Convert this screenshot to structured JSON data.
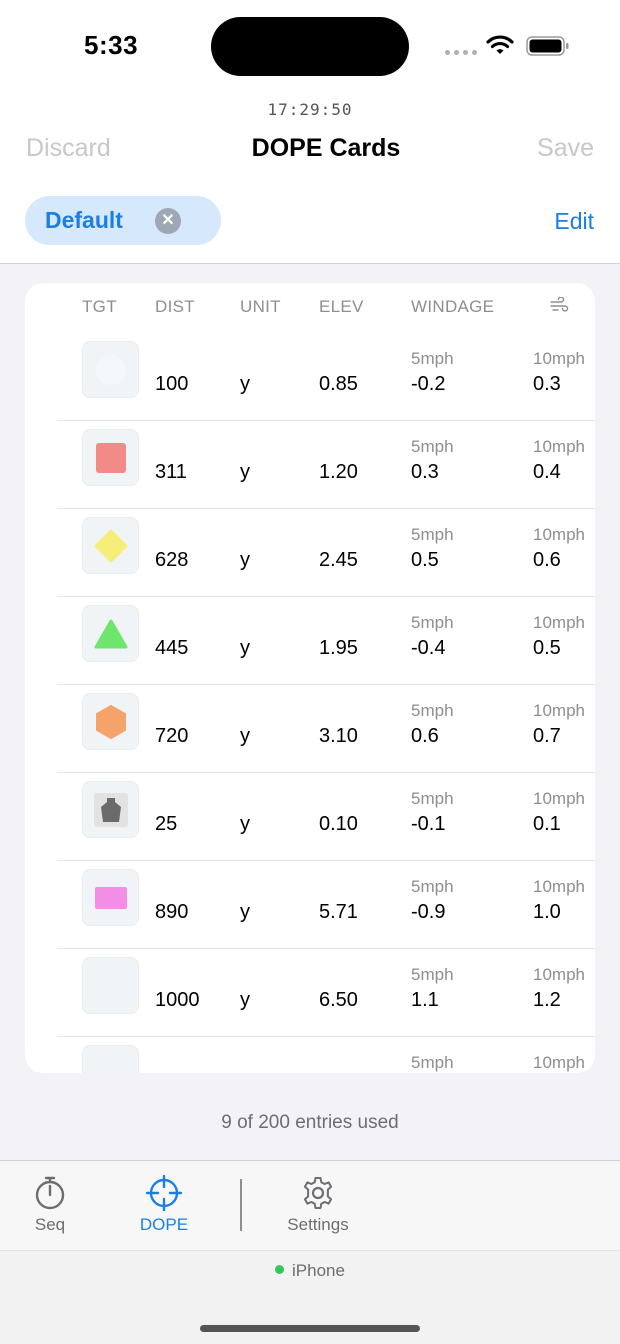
{
  "status_bar": {
    "time": "5:33"
  },
  "clock": "17:29:50",
  "nav": {
    "left": "Discard",
    "title": "DOPE Cards",
    "right": "Save"
  },
  "filter": {
    "chip_label": "Default",
    "edit_label": "Edit"
  },
  "table": {
    "headers": {
      "tgt": "TGT",
      "dist": "DIST",
      "unit": "UNIT",
      "elev": "ELEV",
      "windage": "WINDAGE",
      "wind_icon": "wind-icon"
    },
    "rows": [
      {
        "target": "circle-white",
        "target_color": "#f4f8fa",
        "dist": "100",
        "unit": "y",
        "elev": "0.85",
        "w1_label": "5mph",
        "w1": "-0.2",
        "w2_label": "10mph",
        "w2": "0.3"
      },
      {
        "target": "square-red",
        "target_color": "#f28a87",
        "dist": "311",
        "unit": "y",
        "elev": "1.20",
        "w1_label": "5mph",
        "w1": "0.3",
        "w2_label": "10mph",
        "w2": "0.4"
      },
      {
        "target": "diamond-yellow",
        "target_color": "#f7ee7a",
        "dist": "628",
        "unit": "y",
        "elev": "2.45",
        "w1_label": "5mph",
        "w1": "0.5",
        "w2_label": "10mph",
        "w2": "0.6"
      },
      {
        "target": "triangle-green",
        "target_color": "#6ee66e",
        "dist": "445",
        "unit": "y",
        "elev": "1.95",
        "w1_label": "5mph",
        "w1": "-0.4",
        "w2_label": "10mph",
        "w2": "0.5"
      },
      {
        "target": "hexagon-orange",
        "target_color": "#f6a36b",
        "dist": "720",
        "unit": "y",
        "elev": "3.10",
        "w1_label": "5mph",
        "w1": "0.6",
        "w2_label": "10mph",
        "w2": "0.7"
      },
      {
        "target": "ipsc-gray",
        "target_color": "#6b6b6b",
        "dist": "25",
        "unit": "y",
        "elev": "0.10",
        "w1_label": "5mph",
        "w1": "-0.1",
        "w2_label": "10mph",
        "w2": "0.1"
      },
      {
        "target": "rectangle-pink",
        "target_color": "#f38ee6",
        "dist": "890",
        "unit": "y",
        "elev": "5.71",
        "w1_label": "5mph",
        "w1": "-0.9",
        "w2_label": "10mph",
        "w2": "1.0"
      },
      {
        "target": "blank",
        "target_color": "#f4f8fa",
        "dist": "1000",
        "unit": "y",
        "elev": "6.50",
        "w1_label": "5mph",
        "w1": "1.1",
        "w2_label": "10mph",
        "w2": "1.2"
      },
      {
        "target": "blank",
        "target_color": "#f4f8fa",
        "dist": "",
        "unit": "",
        "elev": "",
        "w1_label": "5mph",
        "w1": "",
        "w2_label": "10mph",
        "w2": ""
      }
    ]
  },
  "footer_note": "9 of 200 entries used",
  "tabs": [
    {
      "label": "Seq",
      "icon": "stopwatch-icon",
      "active": false
    },
    {
      "label": "DOPE",
      "icon": "crosshair-icon",
      "active": true
    },
    {
      "label": "Settings",
      "icon": "gear-icon",
      "active": false
    }
  ],
  "device": {
    "label": "iPhone",
    "status_color": "#34c759"
  },
  "colors": {
    "accent": "#1a7ee5",
    "inactive": "#6d6d72",
    "disabled": "#c7c7cc"
  }
}
